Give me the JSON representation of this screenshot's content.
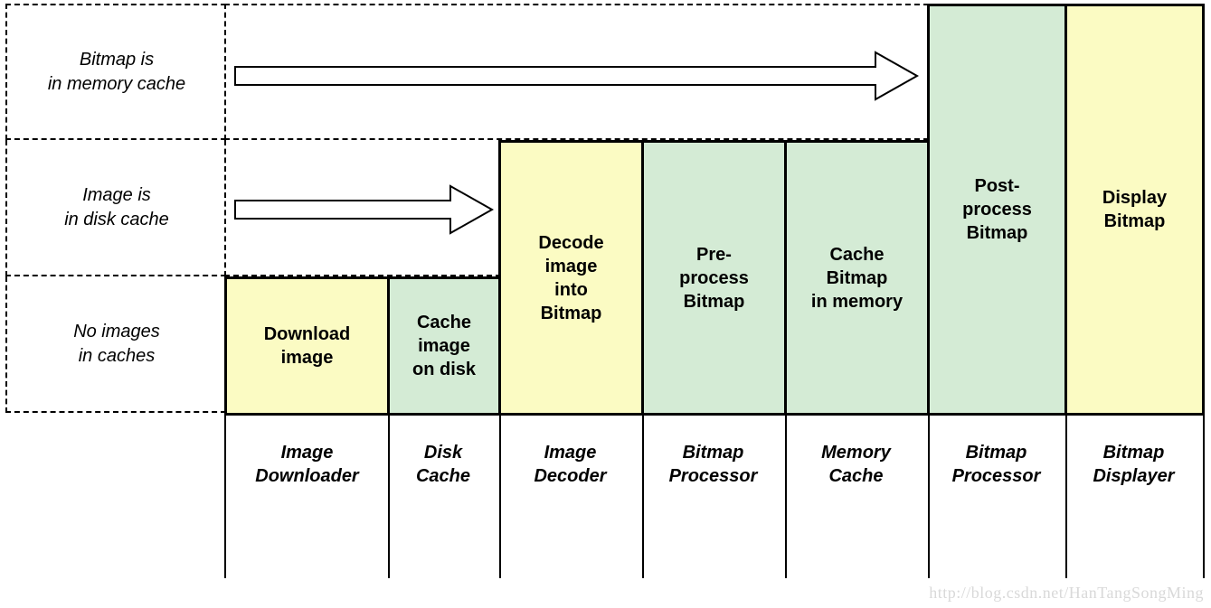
{
  "rows": {
    "memory_cache": "Bitmap is\nin memory cache",
    "disk_cache": "Image is\nin disk cache",
    "no_cache": "No images\nin caches"
  },
  "stages": {
    "download": "Download\nimage",
    "cache_disk": "Cache\nimage\non disk",
    "decode": "Decode\nimage\ninto\nBitmap",
    "preprocess": "Pre-\nprocess\nBitmap",
    "cache_mem": "Cache\nBitmap\nin memory",
    "postprocess": "Post-\nprocess\nBitmap",
    "display": "Display\nBitmap"
  },
  "cols": {
    "downloader": "Image\nDownloader",
    "disk_cache": "Disk\nCache",
    "decoder": "Image\nDecoder",
    "bmp_proc1": "Bitmap\nProcessor",
    "mem_cache": "Memory\nCache",
    "bmp_proc2": "Bitmap\nProcessor",
    "displayer": "Bitmap\nDisplayer"
  },
  "watermark": "http://blog.csdn.net/HanTangSongMing"
}
